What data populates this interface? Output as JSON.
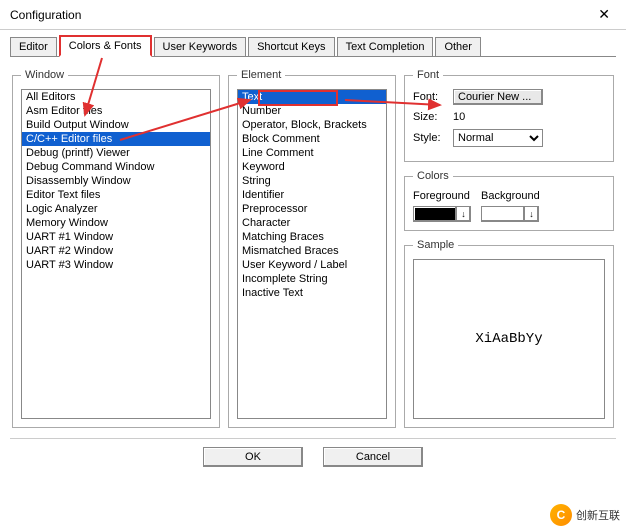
{
  "title": "Configuration",
  "tabs": {
    "t0": "Editor",
    "t1": "Colors & Fonts",
    "t2": "User Keywords",
    "t3": "Shortcut Keys",
    "t4": "Text Completion",
    "t5": "Other"
  },
  "window": {
    "legend": "Window",
    "items": [
      "All Editors",
      "Asm Editor files",
      "Build Output Window",
      "C/C++ Editor files",
      "Debug (printf) Viewer",
      "Debug Command Window",
      "Disassembly Window",
      "Editor Text files",
      "Logic Analyzer",
      "Memory Window",
      "UART #1 Window",
      "UART #2 Window",
      "UART #3 Window"
    ],
    "selectedIndex": 3
  },
  "element": {
    "legend": "Element",
    "items": [
      "Text",
      "Number",
      "Operator, Block, Brackets",
      "Block Comment",
      "Line Comment",
      "Keyword",
      "String",
      "Identifier",
      "Preprocessor",
      "Character",
      "Matching Braces",
      "Mismatched Braces",
      "User Keyword / Label",
      "Incomplete String",
      "Inactive Text"
    ],
    "selectedIndex": 0
  },
  "font": {
    "legend": "Font",
    "fontLabel": "Font:",
    "fontValue": "Courier New ...",
    "sizeLabel": "Size:",
    "sizeValue": "10",
    "styleLabel": "Style:",
    "styleValue": "Normal"
  },
  "colors": {
    "legend": "Colors",
    "foreground": "Foreground",
    "background": "Background"
  },
  "sample": {
    "legend": "Sample",
    "text": "XiAaBbYy"
  },
  "buttons": {
    "ok": "OK",
    "cancel": "Cancel"
  },
  "watermark": "创新互联"
}
